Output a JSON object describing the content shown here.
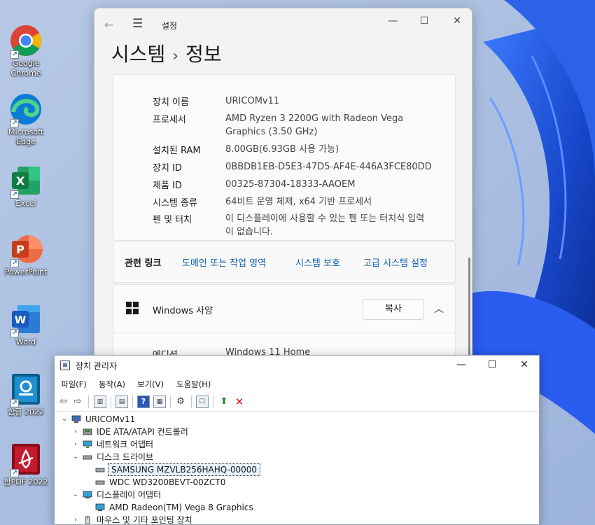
{
  "desktop": {
    "icons": [
      {
        "label": "Google Chrome"
      },
      {
        "label": "Microsoft Edge"
      },
      {
        "label": "Excel"
      },
      {
        "label": "PowerPoint"
      },
      {
        "label": "Word"
      },
      {
        "label": "한글 2022"
      },
      {
        "label": "한PDF 2022"
      }
    ]
  },
  "settings": {
    "app_title": "설정",
    "breadcrumb_parent": "시스템",
    "breadcrumb_sep": "›",
    "breadcrumb_current": "정보",
    "specs": [
      {
        "key": "장치 이름",
        "value": "URICOMv11"
      },
      {
        "key": "프로세서",
        "value": "AMD Ryzen 3 2200G with Radeon Vega Graphics    (3.50 GHz)"
      },
      {
        "key": "설치된 RAM",
        "value": "8.00GB(6.93GB 사용 가능)"
      },
      {
        "key": "장치 ID",
        "value": "0BBDB1EB-D5E3-47D5-AF4E-446A3FCE80DD"
      },
      {
        "key": "제품 ID",
        "value": "00325-87304-18333-AAOEM"
      },
      {
        "key": "시스템 종류",
        "value": "64비트 운영 체제, x64 기반 프로세서"
      },
      {
        "key": "펜 및 터치",
        "value": "이 디스플레이에 사용할 수 있는 펜 또는 터치식 입력이 없습니다."
      }
    ],
    "related_links": {
      "label": "관련 링크",
      "links": [
        "도메인 또는 작업 영역",
        "시스템 보호",
        "고급 시스템 설정"
      ]
    },
    "windows_spec": {
      "title": "Windows 사양",
      "copy_label": "복사",
      "edition_key": "에디션",
      "edition_value": "Windows 11 Home"
    }
  },
  "device_manager": {
    "title": "장치 관리자",
    "menus": [
      "파일(F)",
      "동작(A)",
      "보기(V)",
      "도움말(H)"
    ],
    "tree": [
      {
        "label": "URICOMv11",
        "level": 0,
        "toggle": "⌄",
        "icon": "computer-icon"
      },
      {
        "label": "IDE ATA/ATAPI 컨트롤러",
        "level": 1,
        "toggle": "›",
        "icon": "ide-controller-icon"
      },
      {
        "label": "네트워크 어댑터",
        "level": 1,
        "toggle": "›",
        "icon": "network-adapter-icon"
      },
      {
        "label": "디스크 드라이브",
        "level": 1,
        "toggle": "⌄",
        "icon": "disk-drive-icon"
      },
      {
        "label": "SAMSUNG MZVLB256HAHQ-00000",
        "level": 2,
        "toggle": "",
        "icon": "disk-icon",
        "selected": true
      },
      {
        "label": "WDC WD3200BEVT-00ZCT0",
        "level": 2,
        "toggle": "",
        "icon": "disk-icon"
      },
      {
        "label": "디스플레이 어댑터",
        "level": 1,
        "toggle": "⌄",
        "icon": "display-adapter-icon"
      },
      {
        "label": "AMD Radeon(TM) Vega 8 Graphics",
        "level": 2,
        "toggle": "",
        "icon": "display-icon"
      },
      {
        "label": "마우스 및 기타 포인팅 장치",
        "level": 1,
        "toggle": "›",
        "icon": "mouse-icon"
      }
    ]
  },
  "colors": {
    "accent": "#0a5fb4",
    "wallpaper_blue": "#1f4fd8",
    "window_bg": "#f3f3f3"
  }
}
